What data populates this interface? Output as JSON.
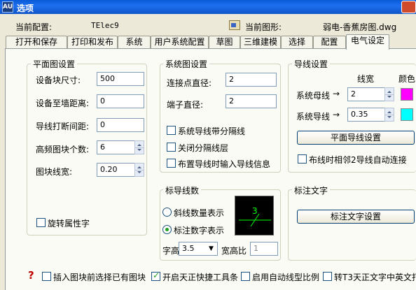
{
  "window": {
    "title": "选项",
    "app_icon": "AU"
  },
  "header": {
    "profile_label": "当前配置:",
    "profile_value": "TElec9",
    "drawing_label": "当前图形:",
    "drawing_value": "弱电-香蕉房图.dwg"
  },
  "tabs": [
    "打开和保存",
    "打印和发布",
    "系统",
    "用户系统配置",
    "草图",
    "三维建模",
    "选择",
    "配置",
    "电气设定"
  ],
  "active_tab": "电气设定",
  "plan_settings": {
    "title": "平面图设置",
    "block_size_label": "设备块尺寸:",
    "block_size_value": "500",
    "wall_distance_label": "设备至墙距离:",
    "wall_distance_value": "0",
    "break_gap_label": "导线打断间距:",
    "break_gap_value": "0",
    "hf_block_count_label": "高频图块个数:",
    "hf_block_count_value": "6",
    "line_width_label": "图块线宽:",
    "line_width_value": "0.20",
    "rotate_attr_label": "旋转属性字",
    "rotate_attr_checked": false
  },
  "system_settings": {
    "title": "系统图设置",
    "node_diameter_label": "连接点直径:",
    "node_diameter_value": "2",
    "terminal_diameter_label": "端子直径:",
    "terminal_diameter_value": "2",
    "sys_wire_separator_label": "系统导线带分隔线",
    "sys_wire_separator_checked": false,
    "close_separator_layer_label": "关闭分隔线层",
    "close_separator_layer_checked": false,
    "input_wire_info_label": "布置导线时输入导线信息",
    "input_wire_info_checked": false
  },
  "wire_settings": {
    "title": "导线设置",
    "width_header": "线宽",
    "color_header": "颜色",
    "sys_bus_label": "系统母线",
    "sys_bus_width": "2",
    "sys_bus_color": "#ff00ff",
    "sys_wire_label": "系统导线",
    "sys_wire_width": "0.35",
    "sys_wire_color": "#00ffff",
    "arrow": "→",
    "plan_wire_button": "平面导线设置",
    "auto_connect_label": "布线时相邻2导线自动连接",
    "auto_connect_checked": false
  },
  "wire_count": {
    "title": "标导线数",
    "slash_label": "斜线数量表示",
    "number_label": "标注数字表示",
    "selected": "number",
    "preview_text": "3",
    "preview_color": "#00ff00",
    "text_height_label": "字高",
    "text_height_value": "3.5",
    "aspect_label": "宽高比",
    "aspect_value": "1"
  },
  "annotation_text": {
    "title": "标注文字",
    "button": "标注文字设置"
  },
  "footer": {
    "help_icon": "?",
    "insert_select_label": "插入图块前选择已有图块",
    "insert_select_checked": false,
    "toolbar_label": "开启天正快捷工具条",
    "toolbar_checked": true,
    "auto_linetype_label": "启用自动线型比例",
    "auto_linetype_checked": false,
    "t3_text_label": "转T3天正文字中英文打",
    "t3_text_checked": false
  }
}
